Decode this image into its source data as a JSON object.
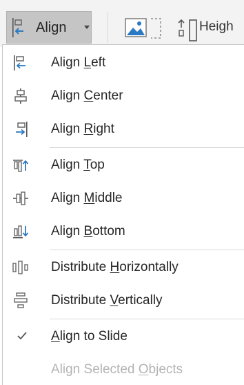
{
  "ribbon": {
    "align_button": {
      "label": "Align",
      "icon": "align-left-icon"
    },
    "picture_icon": "picture-icon",
    "height_label": "Heigh"
  },
  "menu": {
    "items": [
      {
        "pre": "Align ",
        "key": "L",
        "post": "eft",
        "icon": "align-left-icon"
      },
      {
        "pre": "Align ",
        "key": "C",
        "post": "enter",
        "icon": "align-center-icon"
      },
      {
        "pre": "Align ",
        "key": "R",
        "post": "ight",
        "icon": "align-right-icon"
      },
      {
        "pre": "Align ",
        "key": "T",
        "post": "op",
        "icon": "align-top-icon"
      },
      {
        "pre": "Align ",
        "key": "M",
        "post": "iddle",
        "icon": "align-middle-icon"
      },
      {
        "pre": "Align ",
        "key": "B",
        "post": "ottom",
        "icon": "align-bottom-icon"
      },
      {
        "pre": "Distribute ",
        "key": "H",
        "post": "orizontally",
        "icon": "distribute-horizontally-icon"
      },
      {
        "pre": "Distribute ",
        "key": "V",
        "post": "ertically",
        "icon": "distribute-vertically-icon"
      },
      {
        "pre": "",
        "key": "A",
        "post": "lign to Slide",
        "icon": "checkmark-icon",
        "checked": true
      },
      {
        "pre": "Align Selected ",
        "key": "O",
        "post": "bjects",
        "disabled": true
      }
    ]
  },
  "colors": {
    "accent_blue": "#2b79c2",
    "icon_gray": "#6d6d6d",
    "text": "#262626",
    "disabled_text": "#b3b3b3"
  }
}
